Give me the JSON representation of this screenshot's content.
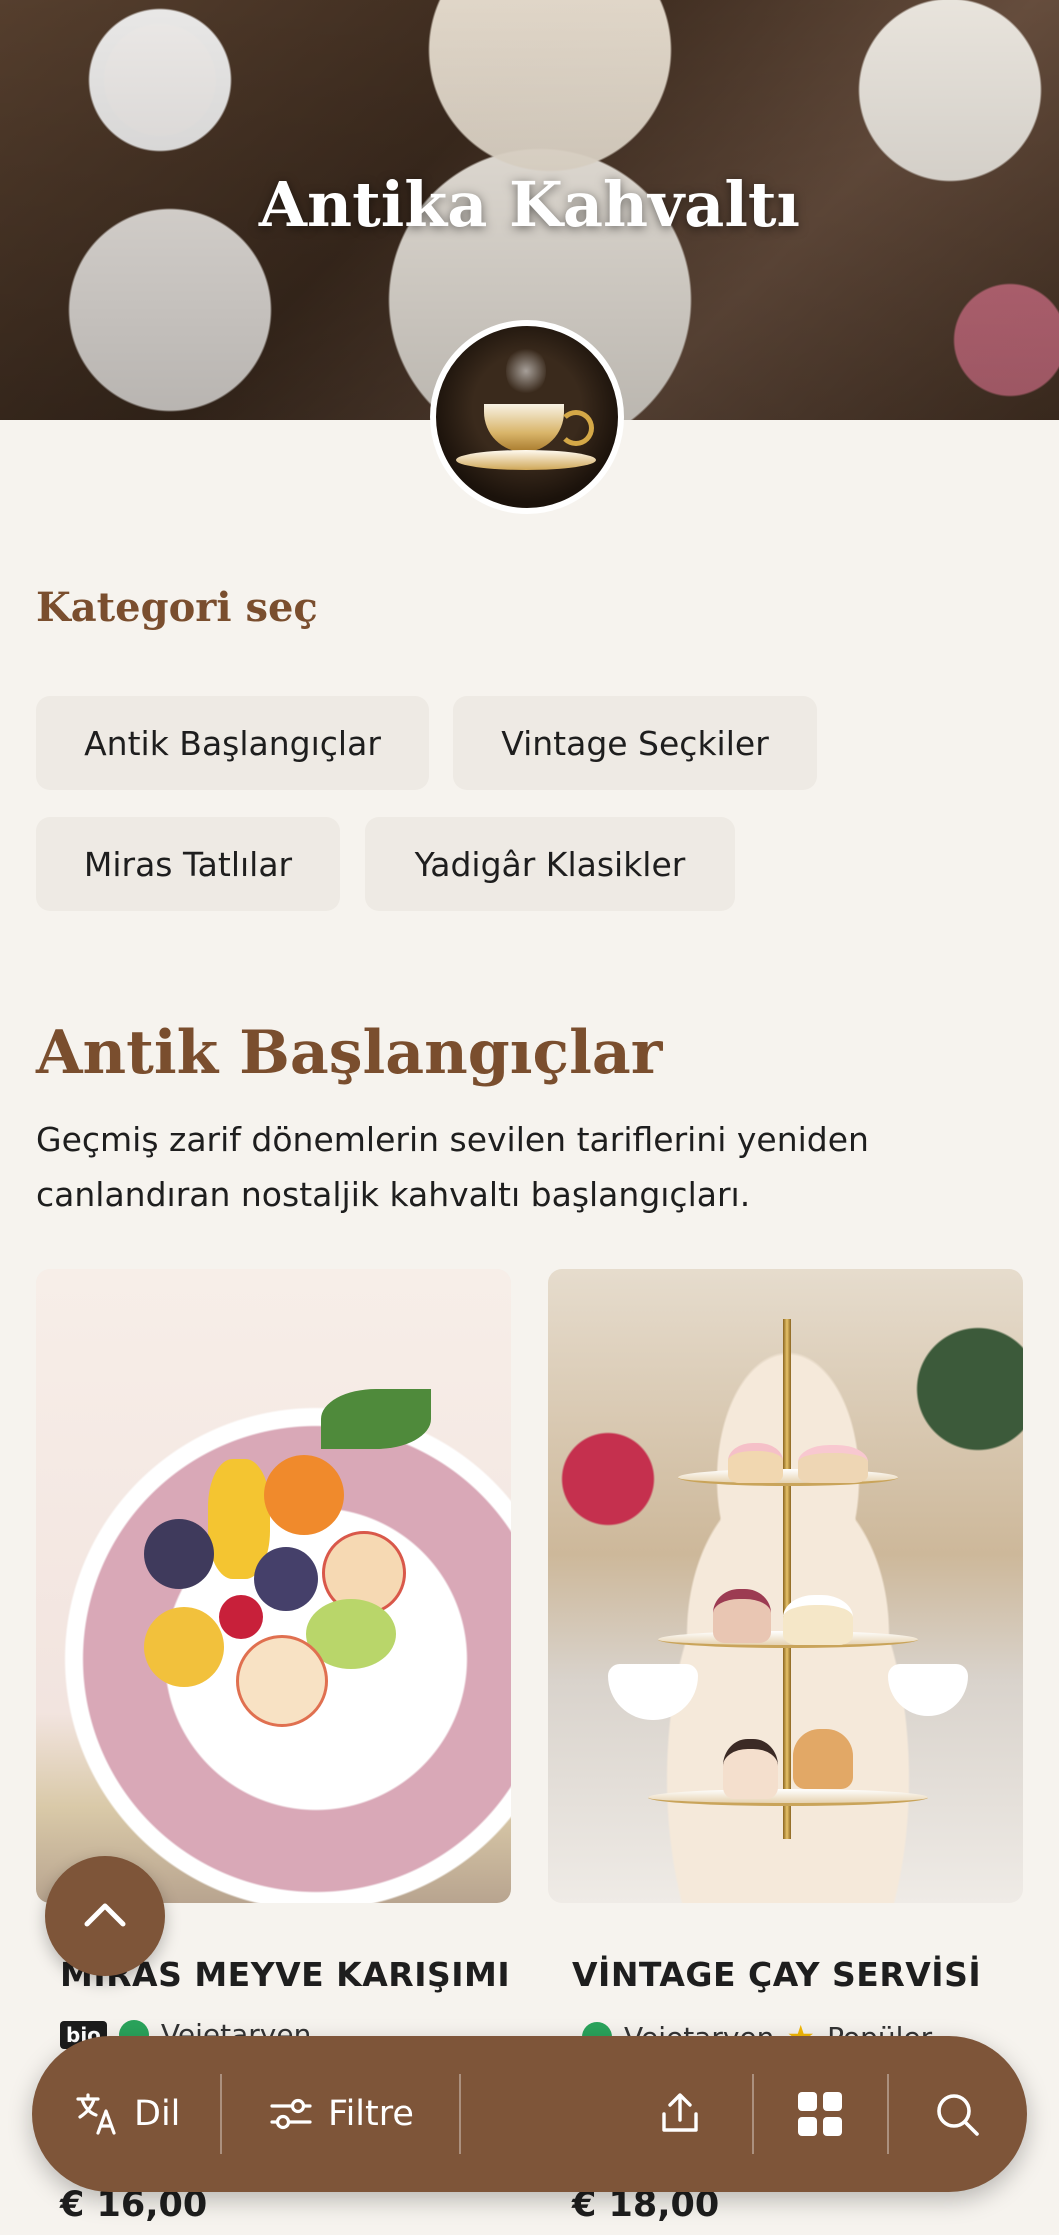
{
  "hero": {
    "title": "Antika Kahvaltı"
  },
  "category": {
    "heading": "Kategori seç",
    "chips": [
      "Antik Başlangıçlar",
      "Vintage Seçkiler",
      "Miras Tatlılar",
      "Yadigâr Klasikler"
    ]
  },
  "section": {
    "title": "Antik Başlangıçlar",
    "description": "Geçmiş zarif dönemlerin sevilen tariflerini yeniden canlandıran nostaljik kahvaltı başlangıçları."
  },
  "products": [
    {
      "name": "MİRAS MEYVE KARIŞIMI",
      "badges": [
        "bio"
      ],
      "tags": [
        "Vejetaryen"
      ],
      "price": "€ 16,00"
    },
    {
      "name": "VİNTAGE ÇAY SERVİSİ",
      "badges": [],
      "tags": [
        "Vejetaryen",
        "Popüler"
      ],
      "price": "€ 18,00"
    }
  ],
  "bottom_bar": {
    "language": "Dil",
    "filter": "Filtre"
  },
  "colors": {
    "accent": "#7e5539",
    "heading": "#7a4e2e",
    "chip_bg": "#eeeae4",
    "background": "#f6f3ee"
  },
  "icons": [
    "translate-icon",
    "filter-icon",
    "share-icon",
    "grid-icon",
    "search-icon",
    "chevron-up-icon"
  ]
}
